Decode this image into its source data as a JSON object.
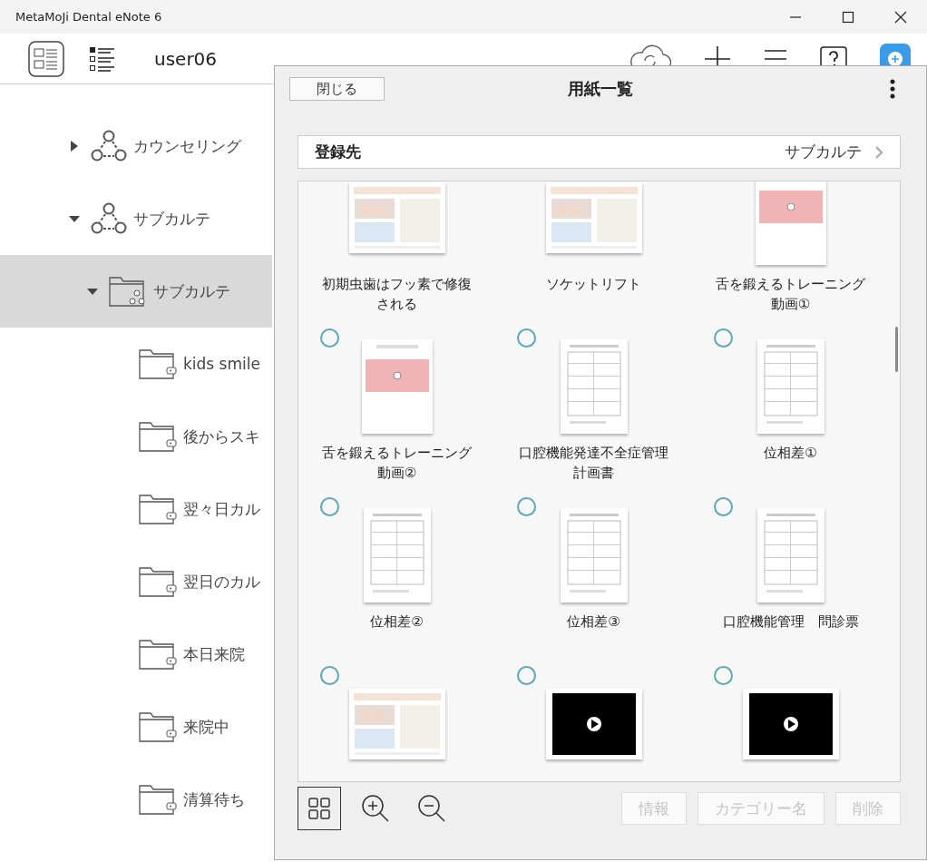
{
  "window": {
    "title": "MetaMoJi Dental eNote 6"
  },
  "toolbar": {
    "user": "user06"
  },
  "tree": [
    {
      "label": "カウンセリング",
      "kind": "group",
      "expanded": false,
      "selected": false
    },
    {
      "label": "サブカルテ",
      "kind": "group",
      "expanded": true,
      "selected": false,
      "children": [
        {
          "label": "サブカルテ",
          "kind": "folder-group",
          "expanded": true,
          "selected": true,
          "children": [
            {
              "label": "kids smile",
              "kind": "folder",
              "selected": false
            },
            {
              "label": "後からスキ",
              "kind": "folder",
              "selected": false
            },
            {
              "label": "翌々日カル",
              "kind": "folder",
              "selected": false
            },
            {
              "label": "翌日のカル",
              "kind": "folder",
              "selected": false
            },
            {
              "label": "本日来院",
              "kind": "folder",
              "selected": false
            },
            {
              "label": "来院中",
              "kind": "folder",
              "selected": false
            },
            {
              "label": "清算待ち",
              "kind": "folder",
              "selected": false
            }
          ]
        }
      ]
    }
  ],
  "dialog": {
    "close": "閉じる",
    "title": "用紙一覧",
    "destination": {
      "label": "登録先",
      "value": "サブカルテ"
    },
    "items": [
      {
        "label": "初期虫歯はフッ素で修復される",
        "kind": "landscape-doc"
      },
      {
        "label": "ソケットリフト",
        "kind": "landscape-doc"
      },
      {
        "label": "舌を鍛えるトレーニング動画①",
        "kind": "portrait-video"
      },
      {
        "label": "舌を鍛えるトレーニング動画②",
        "kind": "portrait-video",
        "selected": false
      },
      {
        "label": "口腔機能発達不全症管理計画書",
        "kind": "portrait-doc",
        "selected": false
      },
      {
        "label": "位相差①",
        "kind": "portrait-doc",
        "selected": false
      },
      {
        "label": "位相差②",
        "kind": "portrait-doc",
        "selected": false
      },
      {
        "label": "位相差③",
        "kind": "portrait-doc",
        "selected": false
      },
      {
        "label": "口腔機能管理　問診票",
        "kind": "portrait-doc",
        "selected": false
      },
      {
        "kind": "landscape-doc",
        "selected": false
      },
      {
        "kind": "video",
        "selected": false
      },
      {
        "kind": "video",
        "selected": false
      }
    ],
    "actions": [
      {
        "label": "情報",
        "disabled": true
      },
      {
        "label": "カテゴリー名",
        "disabled": true
      },
      {
        "label": "削除",
        "disabled": true
      }
    ]
  }
}
